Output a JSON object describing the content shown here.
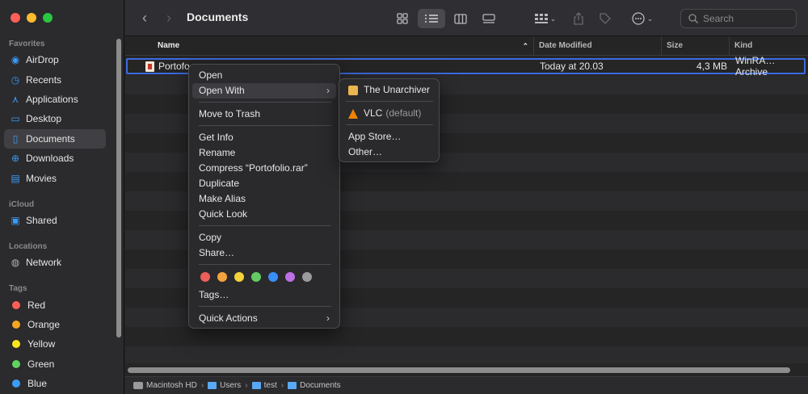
{
  "toolbar": {
    "title": "Documents",
    "search_placeholder": "Search"
  },
  "sidebar": {
    "sections": {
      "favorites": "Favorites",
      "icloud": "iCloud",
      "locations": "Locations",
      "tags": "Tags"
    },
    "favorites": [
      {
        "label": "AirDrop",
        "icon": "airdrop-icon"
      },
      {
        "label": "Recents",
        "icon": "clock-icon"
      },
      {
        "label": "Applications",
        "icon": "applications-icon"
      },
      {
        "label": "Desktop",
        "icon": "desktop-icon"
      },
      {
        "label": "Documents",
        "icon": "document-icon"
      },
      {
        "label": "Downloads",
        "icon": "download-icon"
      },
      {
        "label": "Movies",
        "icon": "film-icon"
      }
    ],
    "icloud": [
      {
        "label": "Shared",
        "icon": "shared-folder-icon"
      }
    ],
    "locations": [
      {
        "label": "Network",
        "icon": "globe-icon"
      }
    ],
    "tags": [
      {
        "label": "Red",
        "color": "#ff5f57"
      },
      {
        "label": "Orange",
        "color": "#f5a623"
      },
      {
        "label": "Yellow",
        "color": "#f8e71c"
      },
      {
        "label": "Green",
        "color": "#5fd35f"
      },
      {
        "label": "Blue",
        "color": "#3b9cf8"
      }
    ]
  },
  "columns": {
    "name": "Name",
    "date": "Date Modified",
    "size": "Size",
    "kind": "Kind"
  },
  "file": {
    "name": "Portofo",
    "date": "Today at 20.03",
    "size": "4,3 MB",
    "kind": "WinRA…Archive"
  },
  "context_menu": {
    "open": "Open",
    "open_with": "Open With",
    "move_to_trash": "Move to Trash",
    "get_info": "Get Info",
    "rename": "Rename",
    "compress": "Compress “Portofolio.rar”",
    "duplicate": "Duplicate",
    "make_alias": "Make Alias",
    "quick_look": "Quick Look",
    "copy": "Copy",
    "share": "Share…",
    "tag_colors": [
      "#ee5e5a",
      "#f2a33d",
      "#f3d33b",
      "#62cc62",
      "#3a8ef6",
      "#bd6fe4",
      "#9b9b9d"
    ],
    "tags": "Tags…",
    "quick_actions": "Quick Actions"
  },
  "open_with_menu": {
    "unarchiver": "The Unarchiver",
    "vlc": "VLC",
    "vlc_default": "(default)",
    "app_store": "App Store…",
    "other": "Other…"
  },
  "path": [
    "Macintosh HD",
    "Users",
    "test",
    "Documents"
  ]
}
